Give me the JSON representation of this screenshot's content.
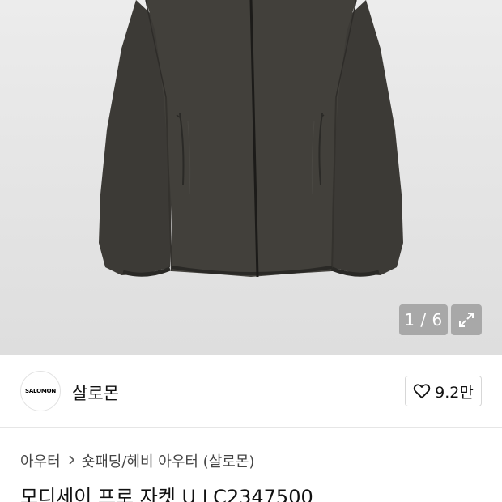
{
  "gallery": {
    "image_alt": "jacket",
    "counter": "1 / 6",
    "expand_icon": "expand-icon"
  },
  "brand": {
    "logo_text": "SALOMON",
    "name": "살로몬",
    "like_icon": "heart-icon",
    "like_count": "9.2만"
  },
  "breadcrumb": {
    "items": [
      "아우터",
      "숏패딩/헤비 아우터 (살로몬)"
    ],
    "separator_icon": "chevron-right-icon"
  },
  "product": {
    "title": "모디세이 프로 자켓 U LC2347500"
  },
  "colors": {
    "jacket": "#3d3b37",
    "background": "#e6e6e6"
  }
}
